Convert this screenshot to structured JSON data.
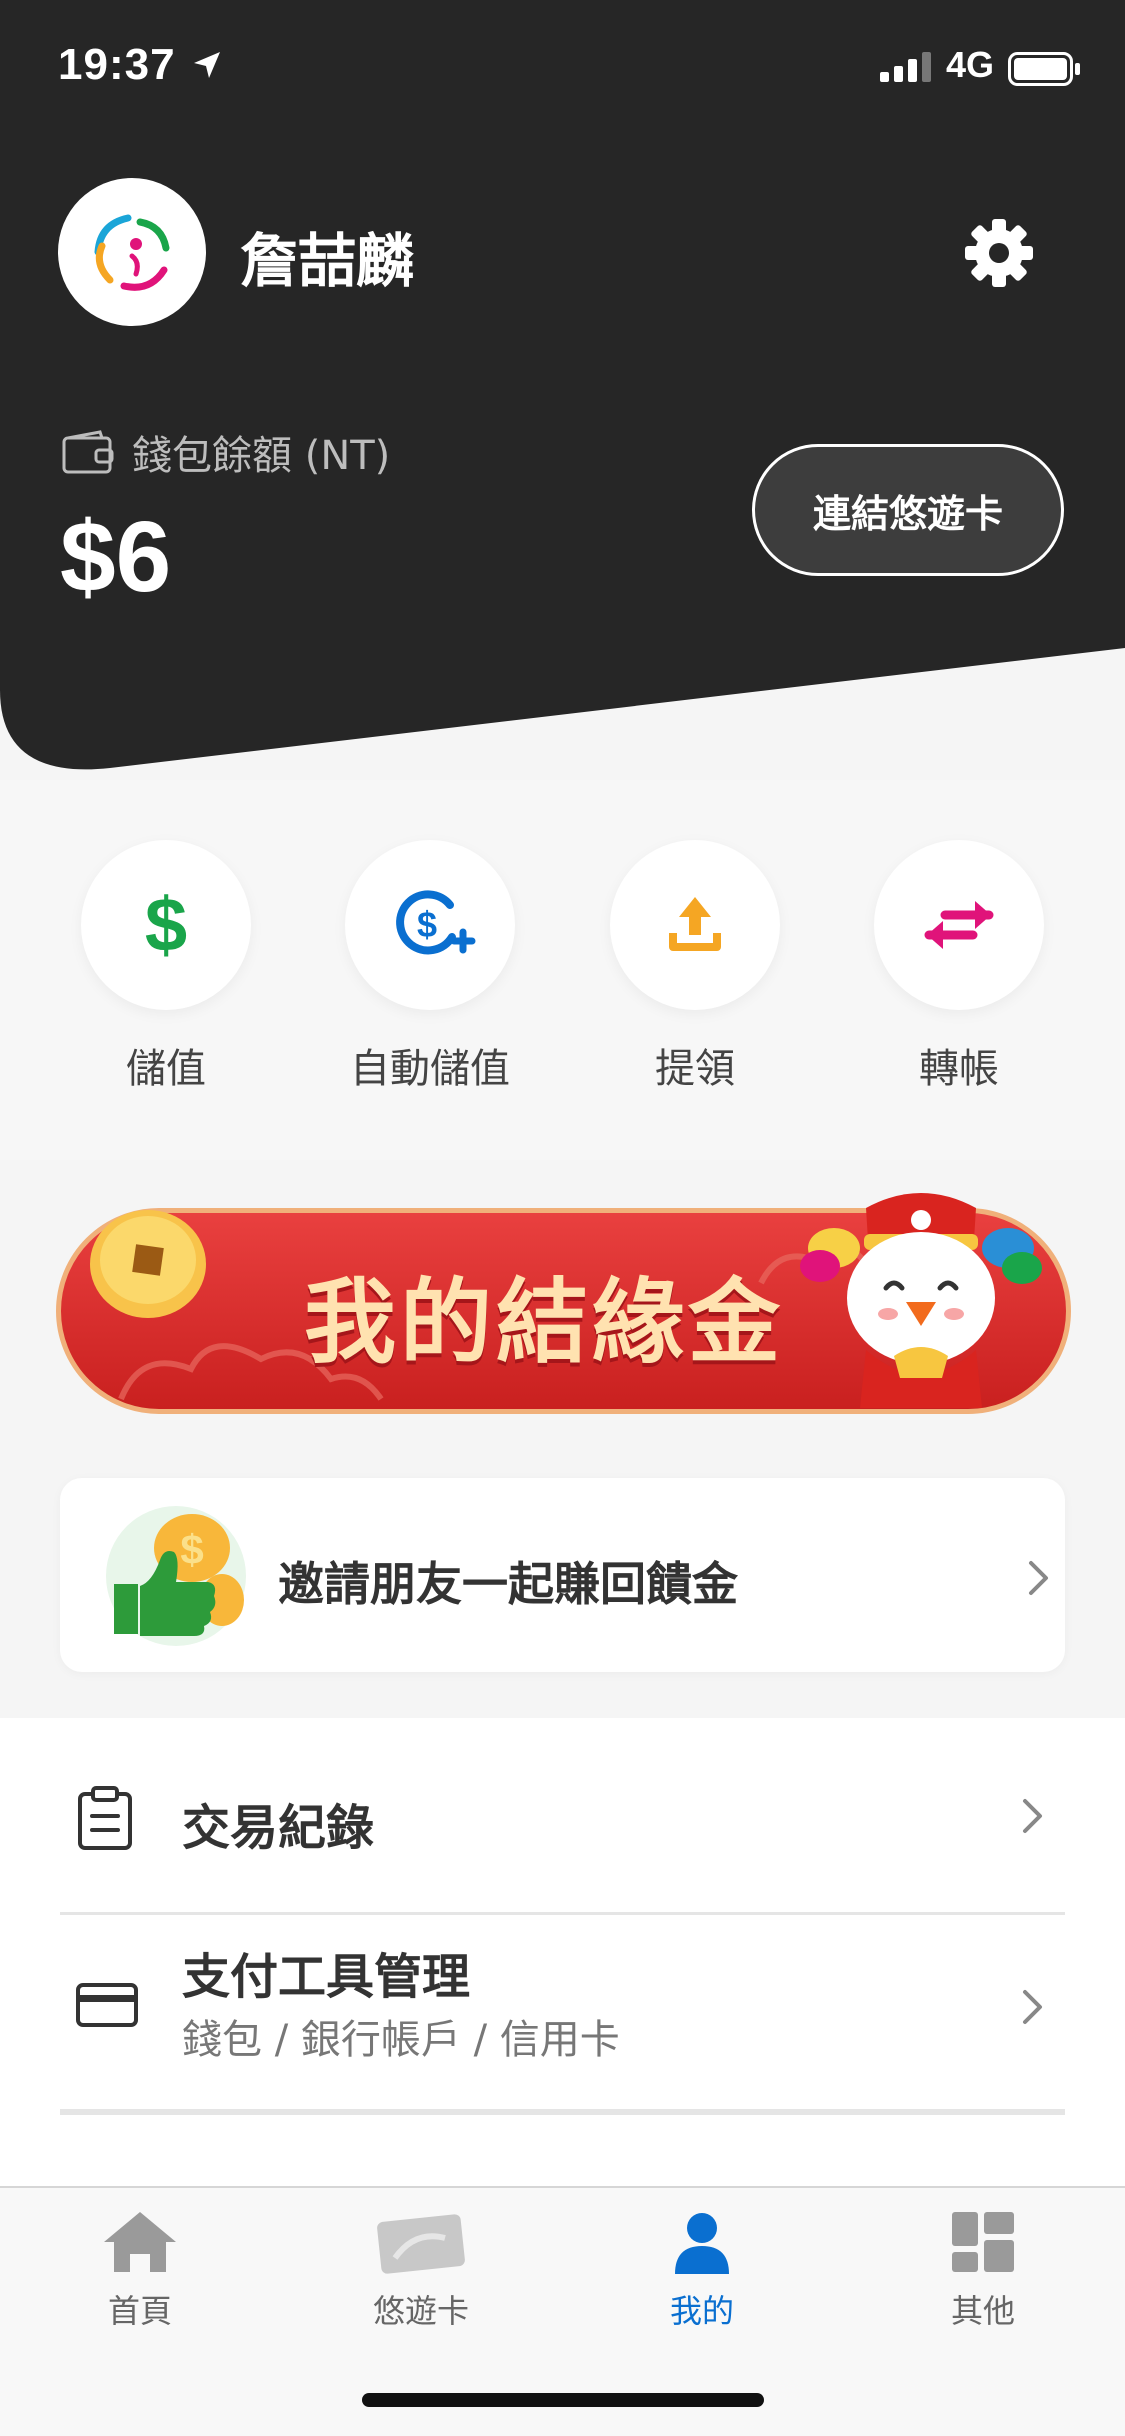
{
  "status_bar": {
    "time": "19:37",
    "network": "4G"
  },
  "profile": {
    "name": "詹喆麟"
  },
  "wallet": {
    "label": "錢包餘額 (NT)",
    "balance": "$6",
    "link_button": "連結悠遊卡"
  },
  "actions": [
    {
      "label": "儲值",
      "icon": "dollar-icon",
      "color": "#1aa54a"
    },
    {
      "label": "自動儲值",
      "icon": "auto-topup-icon",
      "color": "#0a6fd0"
    },
    {
      "label": "提領",
      "icon": "withdraw-icon",
      "color": "#f5a623"
    },
    {
      "label": "轉帳",
      "icon": "transfer-icon",
      "color": "#e0137a"
    }
  ],
  "banner": {
    "title": "我的結緣金"
  },
  "invite": {
    "text": "邀請朋友一起賺回饋金"
  },
  "menu": [
    {
      "title": "交易紀錄",
      "icon": "clipboard-icon"
    },
    {
      "title": "支付工具管理",
      "subtitle": "錢包 / 銀行帳戶 / 信用卡",
      "icon": "credit-card-icon"
    }
  ],
  "tabs": [
    {
      "label": "首頁",
      "icon": "home-icon",
      "active": false
    },
    {
      "label": "悠遊卡",
      "icon": "card-icon",
      "active": false
    },
    {
      "label": "我的",
      "icon": "person-icon",
      "active": true
    },
    {
      "label": "其他",
      "icon": "grid-icon",
      "active": false
    }
  ],
  "colors": {
    "header": "#262626",
    "accent": "#0a6fd0",
    "banner_red": "#d62c2b"
  }
}
